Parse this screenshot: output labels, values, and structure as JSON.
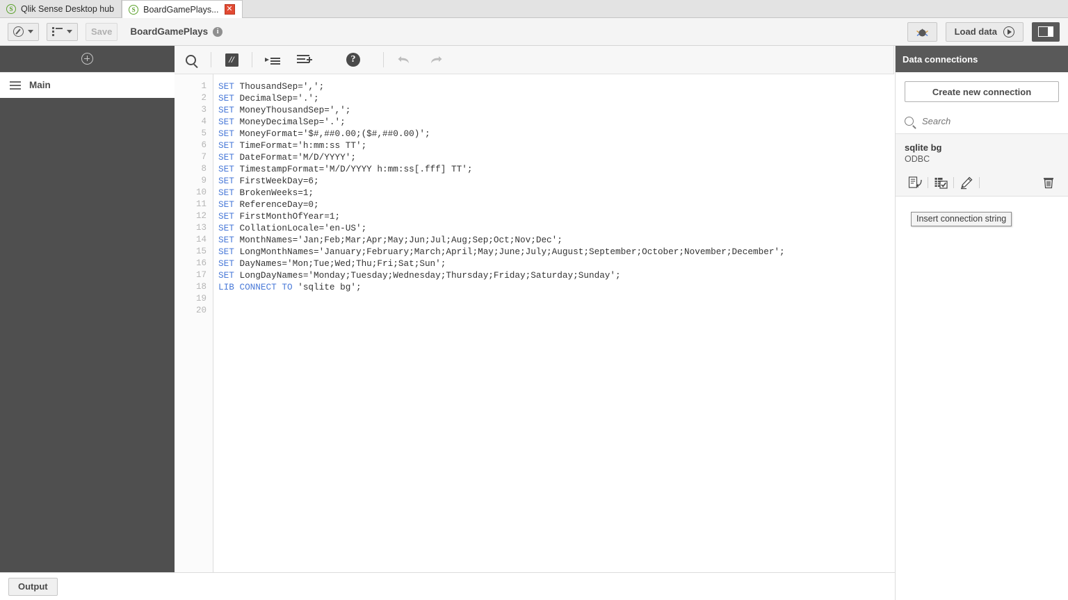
{
  "window": {
    "tabs": [
      {
        "label": "Qlik Sense Desktop hub",
        "icon": "qlik-logo-icon",
        "active": false,
        "closable": false
      },
      {
        "label": "BoardGamePlays...",
        "icon": "qlik-logo-icon",
        "active": true,
        "closable": true
      }
    ]
  },
  "toolbar": {
    "nav_dropdown_icon": "navigation-compass-icon",
    "sheets_dropdown_icon": "list-icon",
    "save_label": "Save",
    "save_enabled": false,
    "app_title": "BoardGamePlays",
    "info_icon": "info-icon",
    "debug_label": "",
    "debug_icon": "debug-bug-icon",
    "load_data_label": "Load data",
    "load_data_icon": "play-circle-icon",
    "panel_toggle_icon": "panel-toggle-icon"
  },
  "sidebar": {
    "add_section_icon": "plus-circle-icon",
    "sections": [
      {
        "label": "Main",
        "icon": "hamburger-icon",
        "selected": true
      }
    ]
  },
  "editor": {
    "toolbar_buttons": [
      {
        "name": "search",
        "icon": "search-icon",
        "label": ""
      },
      {
        "name": "comment",
        "icon": "comment-icon",
        "label": ""
      },
      {
        "name": "indent",
        "icon": "indent-increase-icon",
        "label": ""
      },
      {
        "name": "outdent",
        "icon": "indent-decrease-icon",
        "label": ""
      },
      {
        "name": "help",
        "icon": "help-icon",
        "label": ""
      },
      {
        "name": "undo",
        "icon": "undo-icon",
        "label": ""
      },
      {
        "name": "redo",
        "icon": "redo-icon",
        "label": ""
      }
    ],
    "line_numbers": [
      "1",
      "2",
      "3",
      "4",
      "5",
      "6",
      "7",
      "8",
      "9",
      "10",
      "11",
      "12",
      "13",
      "14",
      "15",
      "16",
      "17",
      "18",
      "19",
      "20"
    ],
    "lines": [
      {
        "keyword": "SET",
        "rest": " ThousandSep=',';"
      },
      {
        "keyword": "SET",
        "rest": " DecimalSep='.';"
      },
      {
        "keyword": "SET",
        "rest": " MoneyThousandSep=',';"
      },
      {
        "keyword": "SET",
        "rest": " MoneyDecimalSep='.';"
      },
      {
        "keyword": "SET",
        "rest": " MoneyFormat='$#,##0.00;($#,##0.00)';"
      },
      {
        "keyword": "SET",
        "rest": " TimeFormat='h:mm:ss TT';"
      },
      {
        "keyword": "SET",
        "rest": " DateFormat='M/D/YYYY';"
      },
      {
        "keyword": "SET",
        "rest": " TimestampFormat='M/D/YYYY h:mm:ss[.fff] TT';"
      },
      {
        "keyword": "SET",
        "rest": " FirstWeekDay=6;"
      },
      {
        "keyword": "SET",
        "rest": " BrokenWeeks=1;"
      },
      {
        "keyword": "SET",
        "rest": " ReferenceDay=0;"
      },
      {
        "keyword": "SET",
        "rest": " FirstMonthOfYear=1;"
      },
      {
        "keyword": "SET",
        "rest": " CollationLocale='en-US';"
      },
      {
        "keyword": "SET",
        "rest": " MonthNames='Jan;Feb;Mar;Apr;May;Jun;Jul;Aug;Sep;Oct;Nov;Dec';"
      },
      {
        "keyword": "SET",
        "rest": " LongMonthNames='January;February;March;April;May;June;July;August;September;October;November;December';"
      },
      {
        "keyword": "SET",
        "rest": " DayNames='Mon;Tue;Wed;Thu;Fri;Sat;Sun';"
      },
      {
        "keyword": "SET",
        "rest": " LongDayNames='Monday;Tuesday;Wednesday;Thursday;Friday;Saturday;Sunday';"
      },
      {
        "keyword": "LIB CONNECT TO",
        "rest": " 'sqlite bg';"
      },
      {
        "keyword": "",
        "rest": ""
      },
      {
        "keyword": "",
        "rest": ""
      }
    ]
  },
  "right_panel": {
    "title": "Data connections",
    "create_button_label": "Create new connection",
    "search_icon": "search-icon",
    "search_placeholder": "Search",
    "search_value": "",
    "connections": [
      {
        "name": "sqlite bg",
        "type": "ODBC",
        "actions": [
          {
            "name": "insert-connection-string",
            "icon": "insert-connection-string-icon"
          },
          {
            "name": "select-data",
            "icon": "select-data-icon"
          },
          {
            "name": "edit-connection",
            "icon": "edit-pencil-icon"
          },
          {
            "name": "delete-connection",
            "icon": "trash-icon"
          }
        ]
      }
    ]
  },
  "tooltip": {
    "text": "Insert connection string"
  },
  "bottom_bar": {
    "output_label": "Output"
  },
  "colors": {
    "dark_chrome": "#595959",
    "sidebar": "#4f4f4f",
    "keyword_blue": "#4a7ad8",
    "accent_green": "#5ca22d",
    "close_red": "#e24a33"
  }
}
